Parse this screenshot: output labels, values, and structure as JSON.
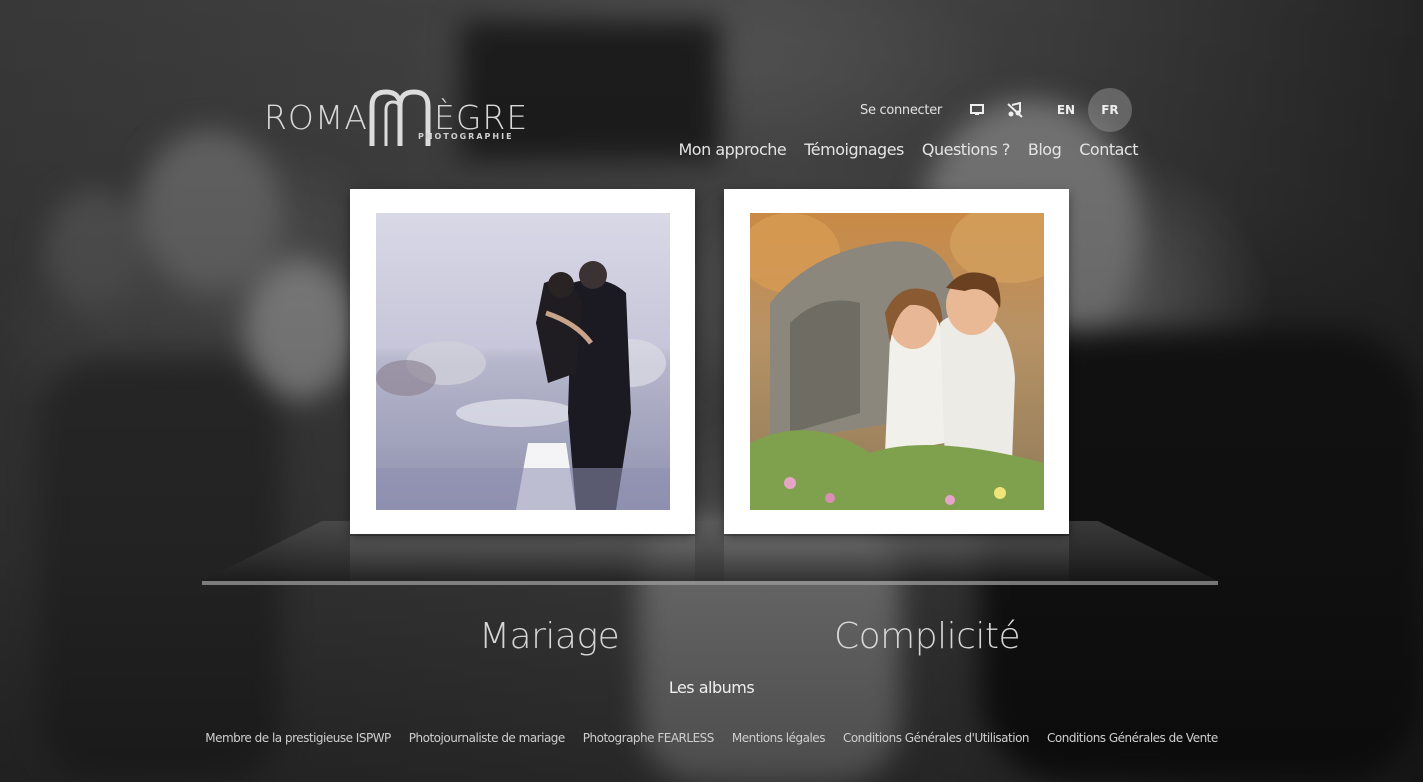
{
  "brand": {
    "word_left": "ROMAI",
    "word_right": "ÈGRE",
    "subtitle": "PHOTOGRAPHIE"
  },
  "topbar": {
    "login": "Se connecter",
    "icons": [
      "monitor-icon",
      "no-music-icon"
    ],
    "languages": [
      {
        "code": "EN",
        "active": false
      },
      {
        "code": "FR",
        "active": true
      }
    ]
  },
  "nav": {
    "items": [
      "Mon approche",
      "Témoignages",
      "Questions ?",
      "Blog",
      "Contact"
    ]
  },
  "albums": {
    "cards": [
      {
        "title": "Mariage",
        "image": "couple embracing in water with white horses"
      },
      {
        "title": "Complicité",
        "image": "young boy and girl sitting on rocks"
      }
    ],
    "section_label": "Les albums"
  },
  "footer": {
    "links": [
      "Membre de la prestigieuse ISPWP",
      "Photojournaliste de mariage",
      "Photographe FEARLESS",
      "Mentions légales",
      "Conditions Générales d'Utilisation",
      "Conditions Générales de Vente"
    ]
  }
}
